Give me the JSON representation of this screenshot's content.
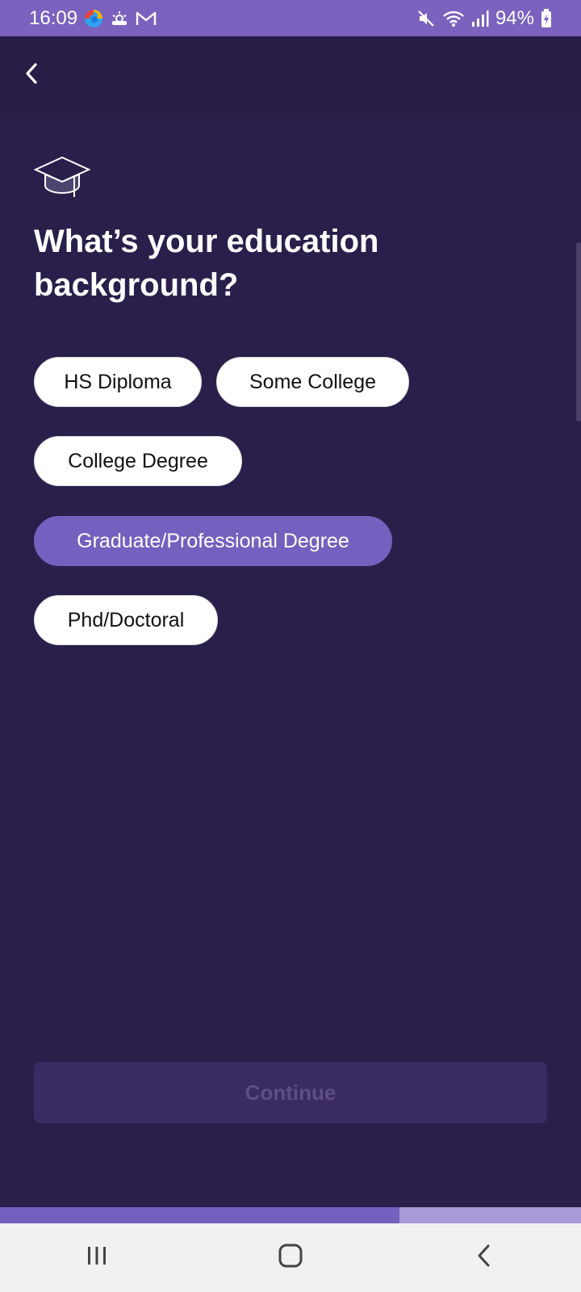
{
  "status_bar": {
    "time": "16:09",
    "battery": "94%",
    "left_icons": [
      "edge-browser-icon",
      "weather-icon",
      "gmail-icon"
    ],
    "right_icons": [
      "mute-icon",
      "wifi-icon",
      "signal-icon",
      "battery-charging-icon"
    ]
  },
  "header": {
    "back_icon": "chevron-left-icon"
  },
  "content": {
    "hero_icon": "graduation-cap-icon",
    "title": "What’s your education background?",
    "options": [
      {
        "label": "HS Diploma",
        "selected": false
      },
      {
        "label": "Some College",
        "selected": false
      },
      {
        "label": "College Degree",
        "selected": false
      },
      {
        "label": "Graduate/Professional Degree",
        "selected": true
      },
      {
        "label": "Phd/Doctoral",
        "selected": false
      }
    ]
  },
  "footer": {
    "continue_label": "Continue",
    "continue_enabled": false
  },
  "progress": {
    "fraction": 0.688
  },
  "nav_bar": {
    "buttons": [
      "recent-apps-icon",
      "home-icon",
      "back-icon"
    ]
  },
  "colors": {
    "status_bar": "#7a62be",
    "background": "#2a1f4a",
    "accent": "#7460be",
    "progress_track": "#a899d8",
    "disabled_button": "#3b2b63"
  }
}
